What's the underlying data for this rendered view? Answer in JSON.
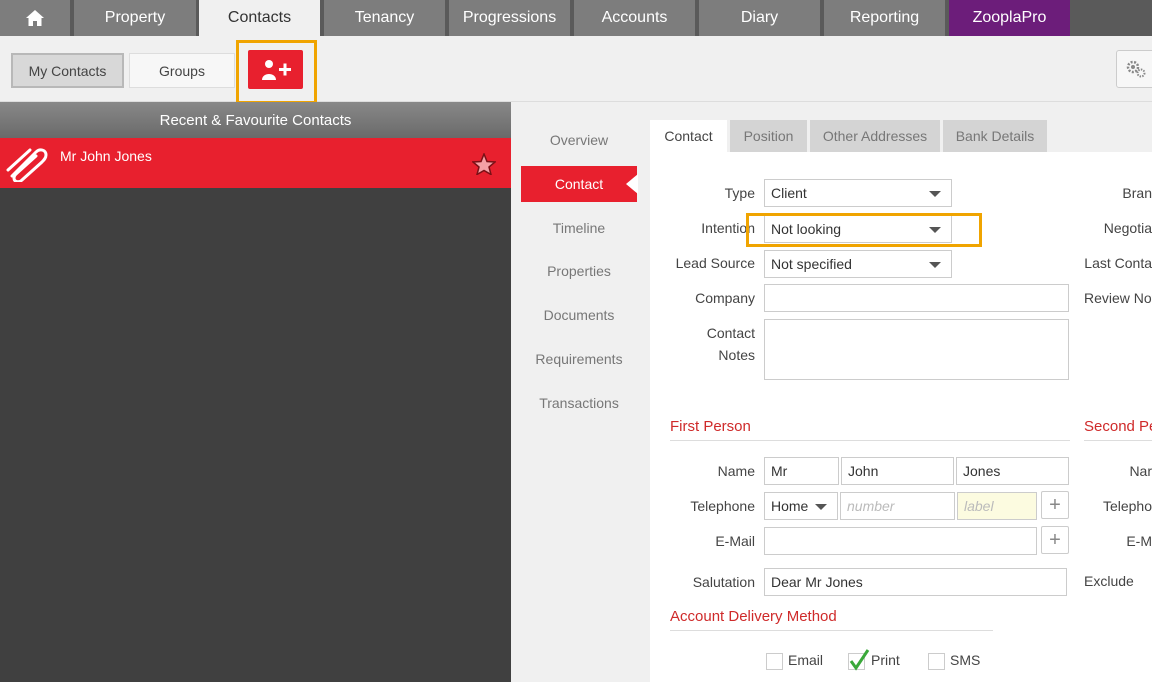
{
  "nav": {
    "tabs": [
      "Property",
      "Contacts",
      "Tenancy",
      "Progressions",
      "Accounts",
      "Diary",
      "Reporting",
      "ZooplaPro"
    ]
  },
  "subbar": {
    "my_contacts": "My Contacts",
    "groups": "Groups"
  },
  "left": {
    "header": "Recent & Favourite Contacts",
    "contacts": [
      {
        "name": "Mr John Jones"
      }
    ]
  },
  "midnav": [
    "Overview",
    "Contact",
    "Timeline",
    "Properties",
    "Documents",
    "Requirements",
    "Transactions"
  ],
  "tabs": [
    "Contact",
    "Position",
    "Other Addresses",
    "Bank Details"
  ],
  "form": {
    "type_label": "Type",
    "type_value": "Client",
    "intention_label": "Intention",
    "intention_value": "Not looking",
    "lead_label": "Lead Source",
    "lead_value": "Not specified",
    "company_label": "Company",
    "company_value": "",
    "notes_label_1": "Contact",
    "notes_label_2": "Notes"
  },
  "right_labels": [
    "Bran",
    "Negotia",
    "Last Conta",
    "Review Not"
  ],
  "first_person": {
    "title": "First Person",
    "name_label": "Name",
    "title_value": "Mr",
    "first_value": "John",
    "last_value": "Jones",
    "tel_label": "Telephone",
    "tel_type": "Home",
    "tel_number_ph": "number",
    "tel_label_ph": "label",
    "email_label": "E-Mail",
    "email_value": "",
    "salutation_label": "Salutation",
    "salutation_value": "Dear Mr Jones"
  },
  "second_person": {
    "title": "Second Pe",
    "labels": [
      "Nar",
      "Telepho",
      "E-M",
      "Exclude"
    ]
  },
  "delivery": {
    "title": "Account Delivery Method",
    "options": [
      {
        "label": "Email",
        "checked": false
      },
      {
        "label": "Print",
        "checked": true
      },
      {
        "label": "SMS",
        "checked": false
      }
    ]
  },
  "colors": {
    "accent": "#e8202e",
    "highlight": "#f0a400",
    "zoopla": "#6c1d7a"
  }
}
